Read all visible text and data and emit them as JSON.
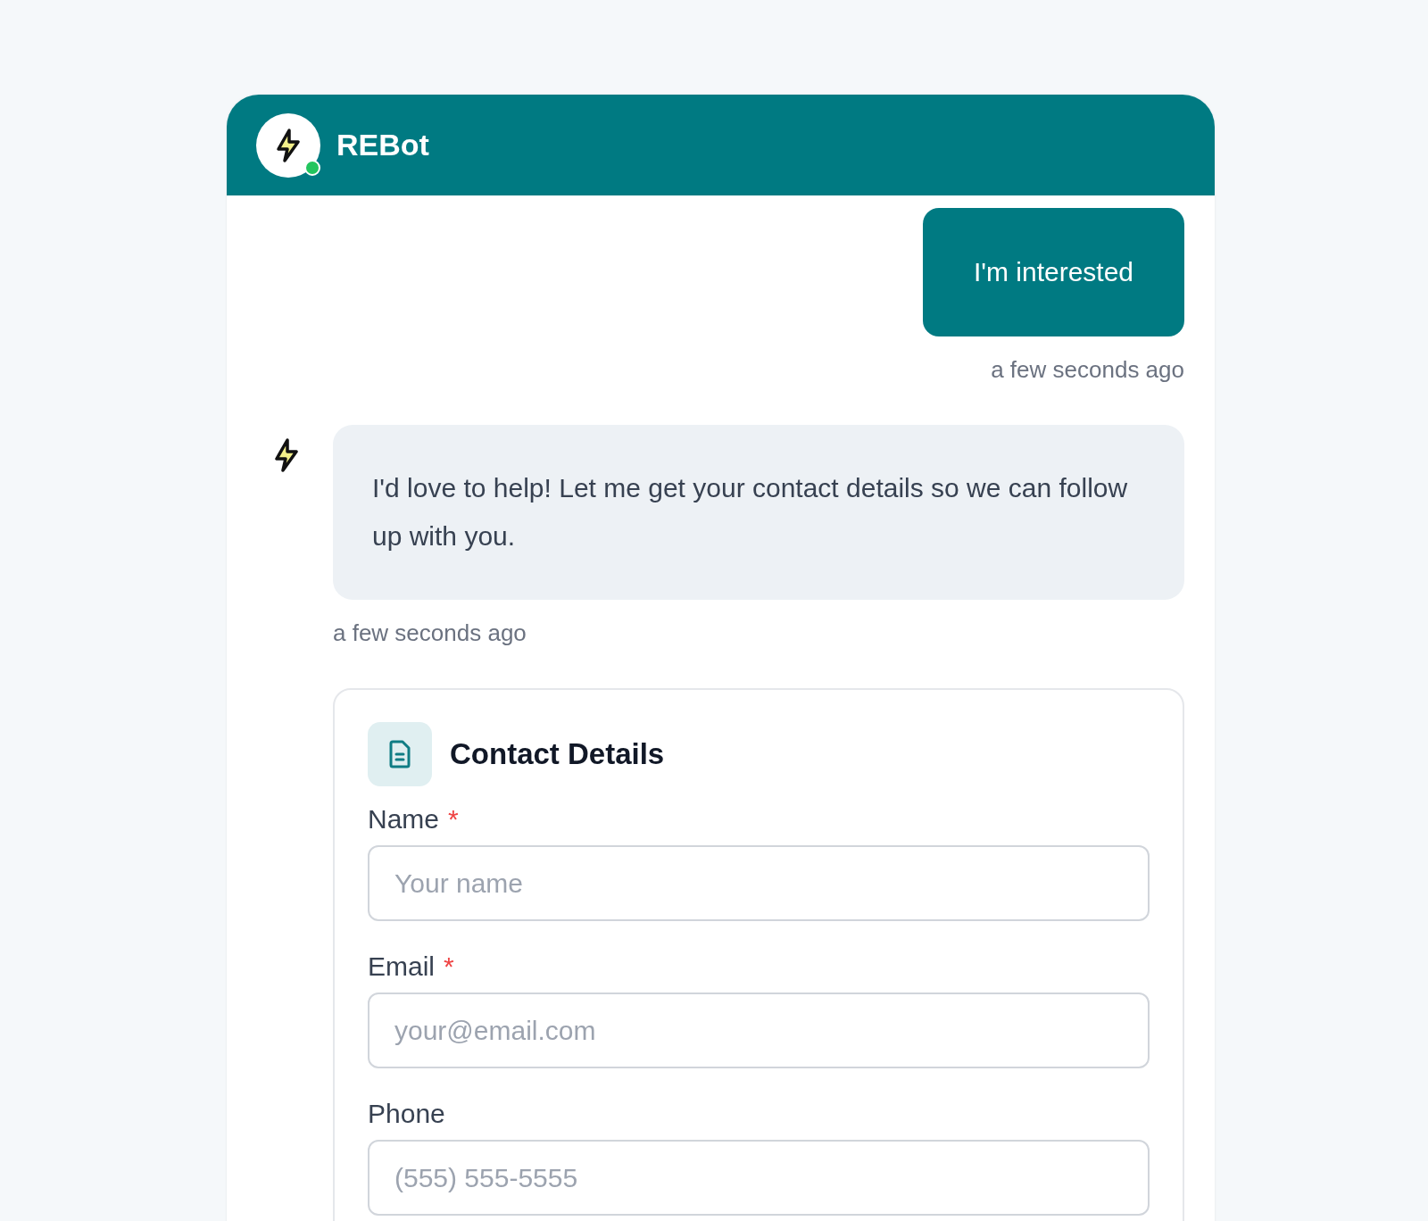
{
  "header": {
    "title": "REBot",
    "online": true
  },
  "messages": [
    {
      "kind": "user",
      "text": "I'm interested",
      "time": "a few seconds ago"
    },
    {
      "kind": "bot",
      "text": "I'd love to help! Let me get your contact details so we can follow up with you.",
      "time": "a few seconds ago"
    }
  ],
  "form": {
    "title": "Contact Details",
    "fields": [
      {
        "label": "Name",
        "required_mark": "*",
        "placeholder": "Your name"
      },
      {
        "label": "Email",
        "required_mark": "*",
        "placeholder": "your@email.com"
      },
      {
        "label": "Phone",
        "placeholder": "(555) 555-5555"
      }
    ]
  }
}
